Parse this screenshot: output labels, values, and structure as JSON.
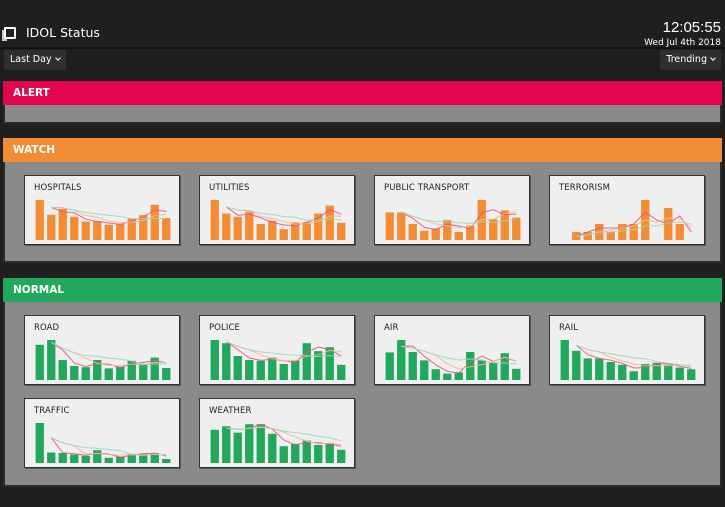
{
  "header": {
    "app_icon": "window-icon",
    "title": "IDOL Status",
    "time": "12:05:55",
    "date": "Wed Jul 4th 2018"
  },
  "toolbar": {
    "range_label": "Last Day",
    "view_label": "Trending"
  },
  "colors": {
    "alert": "#e2064f",
    "watch": "#f28c35",
    "normal": "#22a85c",
    "trend_short": "#e8547a",
    "trend_mid": "#f5b88a",
    "trend_long": "#9ed6c0"
  },
  "sections": {
    "alert": {
      "label": "ALERT",
      "cards": []
    },
    "watch": {
      "label": "WATCH",
      "cards": [
        {
          "title": "HOSPITALS",
          "values": [
            100,
            63,
            78,
            58,
            46,
            47,
            38,
            40,
            54,
            62,
            88,
            55
          ]
        },
        {
          "title": "UTILITIES",
          "values": [
            100,
            66,
            58,
            71,
            40,
            48,
            27,
            44,
            44,
            66,
            86,
            43
          ]
        },
        {
          "title": "PUBLIC TRANSPORT",
          "values": [
            69,
            69,
            40,
            23,
            29,
            50,
            20,
            36,
            100,
            52,
            74,
            56
          ]
        },
        {
          "title": "TERRORISM",
          "values": [
            0,
            20,
            20,
            40,
            20,
            40,
            40,
            100,
            0,
            80,
            40,
            0
          ]
        }
      ]
    },
    "normal": {
      "label": "NORMAL",
      "cards": [
        {
          "title": "ROAD",
          "values": [
            88,
            100,
            50,
            35,
            32,
            50,
            29,
            33,
            48,
            40,
            56,
            30
          ]
        },
        {
          "title": "POLICE",
          "values": [
            100,
            92,
            60,
            50,
            48,
            56,
            40,
            49,
            92,
            72,
            82,
            38
          ]
        },
        {
          "title": "AIR",
          "values": [
            69,
            100,
            70,
            49,
            27,
            16,
            19,
            70,
            49,
            44,
            67,
            28
          ]
        },
        {
          "title": "RAIL",
          "values": [
            100,
            73,
            54,
            54,
            45,
            38,
            22,
            40,
            43,
            38,
            31,
            27
          ]
        },
        {
          "title": "TRAFFIC",
          "values": [
            100,
            26,
            25,
            21,
            18,
            32,
            13,
            16,
            23,
            24,
            25,
            10
          ]
        },
        {
          "title": "WEATHER",
          "values": [
            83,
            92,
            76,
            97,
            97,
            73,
            42,
            48,
            56,
            45,
            50,
            33
          ]
        }
      ]
    }
  }
}
